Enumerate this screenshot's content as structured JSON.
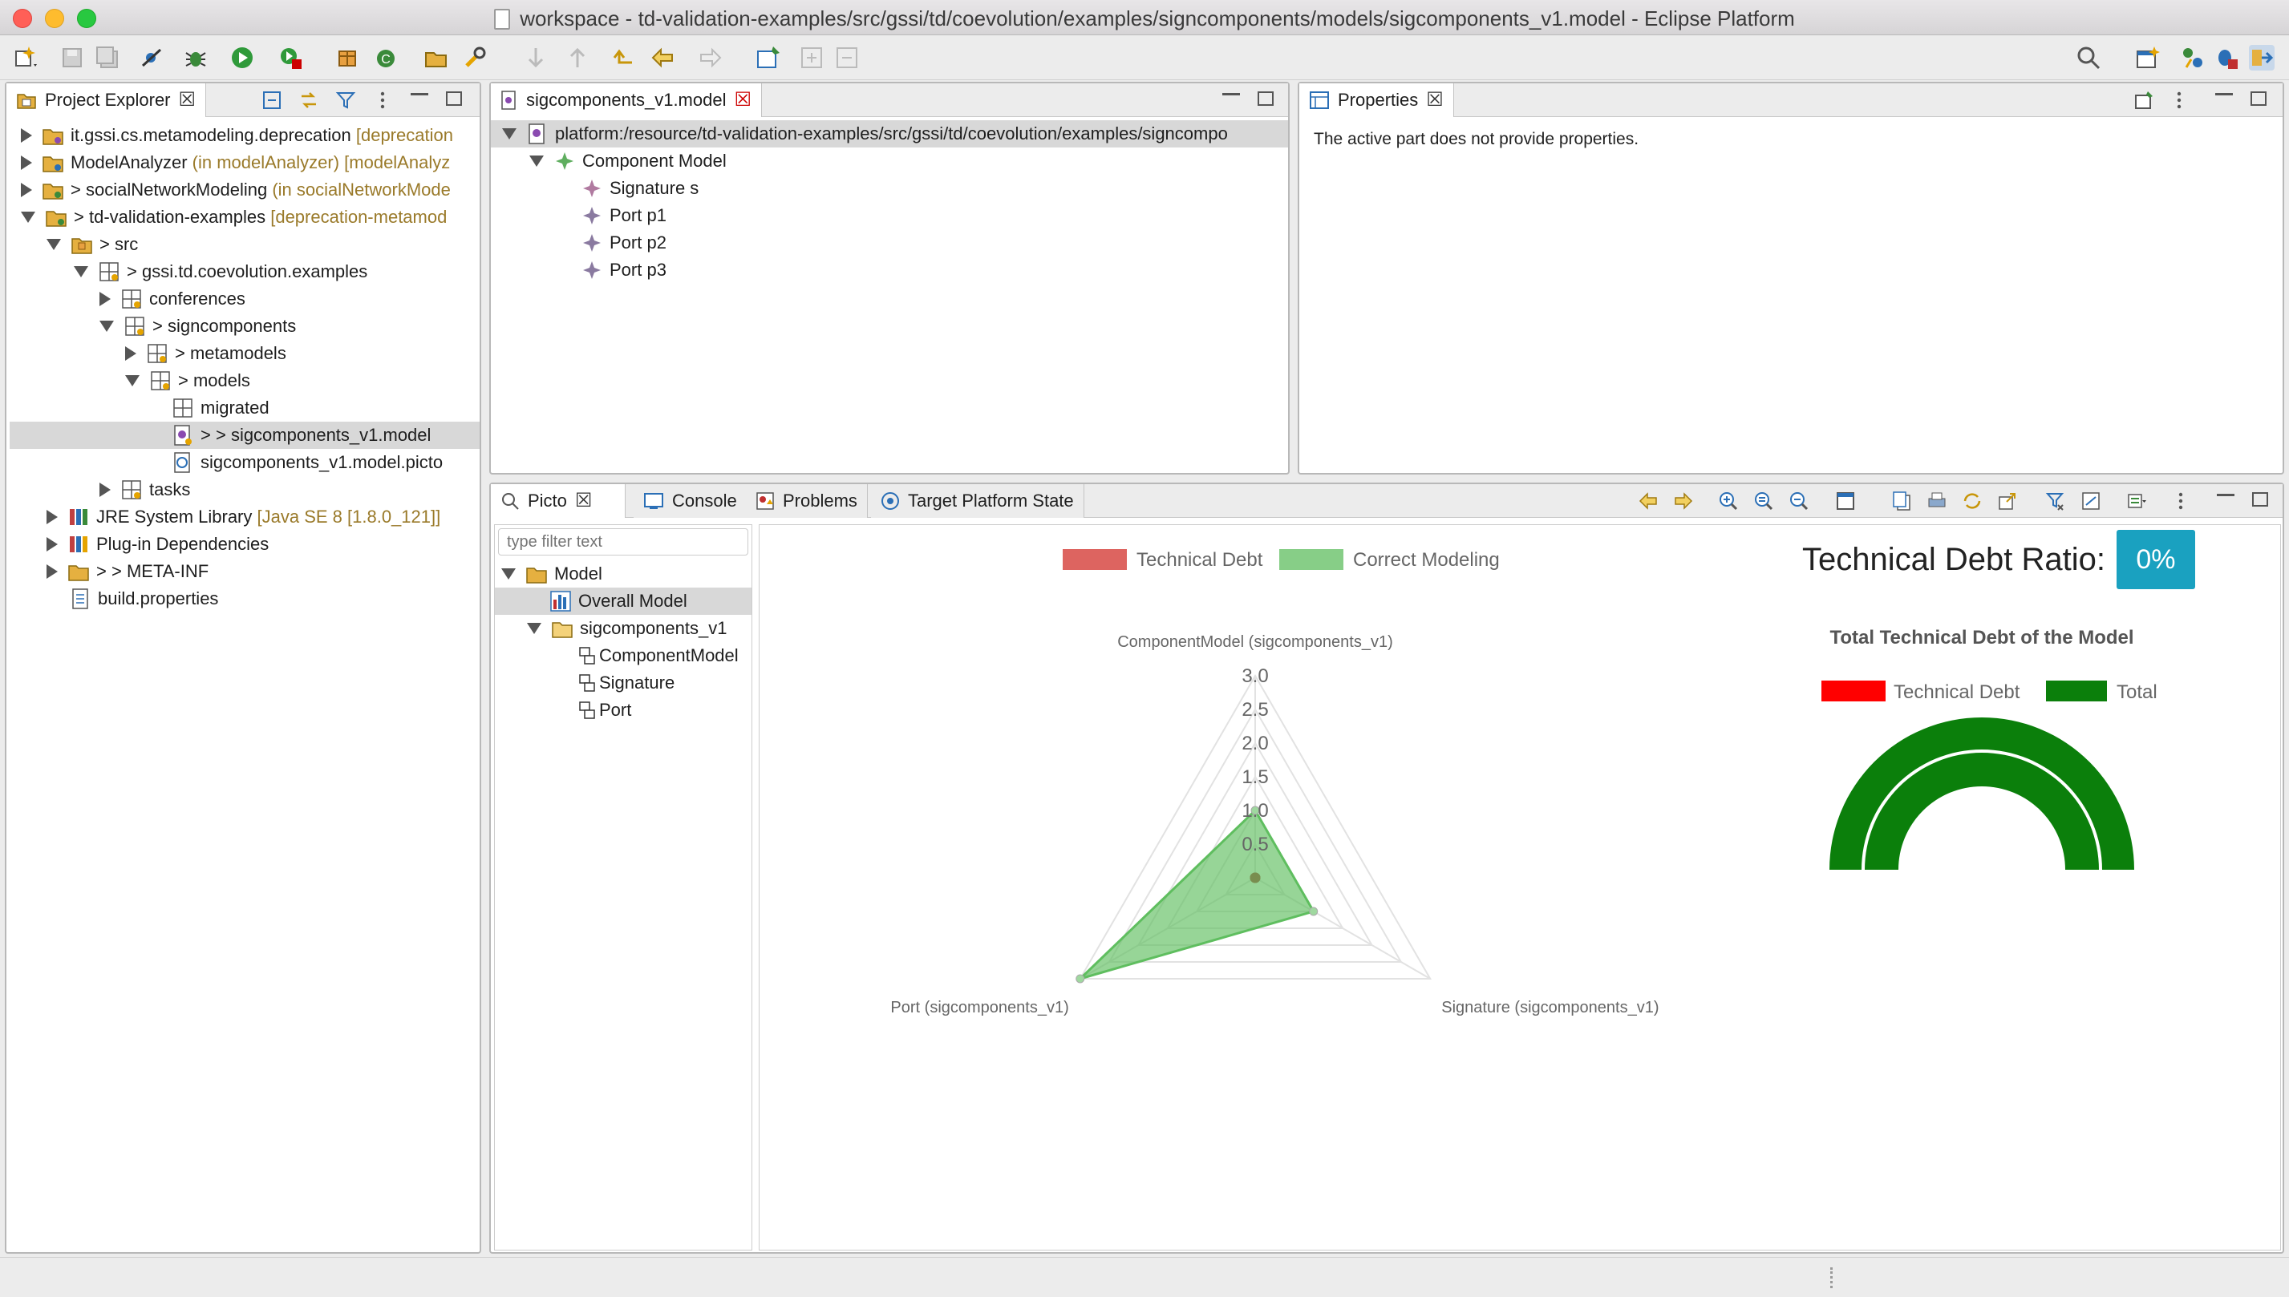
{
  "window": {
    "title": "workspace - td-validation-examples/src/gssi/td/coevolution/examples/signcomponents/models/sigcomponents_v1.model - Eclipse Platform"
  },
  "colors": {
    "accent": "#1aa1c0",
    "green": "#5fbe5f",
    "red": "#d9534f",
    "gauge_green": "#0b7f0b",
    "gauge_red": "#ff0000",
    "project_deco": "#9a7a2a"
  },
  "toolbar": {
    "icons": [
      "new-wizard-icon",
      "save-icon",
      "save-all-icon",
      "skip-breakpoints-icon",
      "debug-icon",
      "run-icon",
      "run-external-icon",
      "new-package-icon",
      "new-class-icon",
      "open-type-icon",
      "search-icon",
      "previous-edit-icon",
      "back-icon",
      "forward-icon",
      "pin-editor-icon",
      "expand-icon",
      "collapse-icon",
      "quick-access-search-icon",
      "perspective-open-icon",
      "perspective-java-icon",
      "perspective-debug-icon",
      "perspective-picto-icon"
    ]
  },
  "project_explorer": {
    "tab_label": "Project Explorer",
    "items": [
      {
        "label": "it.gssi.cs.metamodeling.deprecation",
        "deco": "[deprecation"
      },
      {
        "label": "ModelAnalyzer",
        "deco": "(in modelAnalyzer) [modelAnalyz"
      },
      {
        "prefix": ">",
        "label": "socialNetworkModeling",
        "deco": "(in socialNetworkMode"
      },
      {
        "prefix": ">",
        "label": "td-validation-examples",
        "deco": "[deprecation-metamod"
      },
      {
        "prefix": ">",
        "label": "src"
      },
      {
        "prefix": ">",
        "label": "gssi.td.coevolution.examples"
      },
      {
        "label": "conferences"
      },
      {
        "prefix": ">",
        "label": "signcomponents"
      },
      {
        "prefix": ">",
        "label": "metamodels"
      },
      {
        "prefix": ">",
        "label": "models"
      },
      {
        "label": "migrated"
      },
      {
        "prefix": "> >",
        "label": "sigcomponents_v1.model"
      },
      {
        "label": "sigcomponents_v1.model.picto"
      },
      {
        "label": "tasks"
      },
      {
        "label": "JRE System Library",
        "deco": "[Java SE 8 [1.8.0_121]]"
      },
      {
        "label": "Plug-in Dependencies"
      },
      {
        "prefix": "> >",
        "label": "META-INF"
      },
      {
        "label": "build.properties"
      }
    ]
  },
  "editor": {
    "tab_label": "sigcomponents_v1.model",
    "root": "platform:/resource/td-validation-examples/src/gssi/td/coevolution/examples/signcompo",
    "items": [
      "Component Model",
      "Signature s",
      "Port p1",
      "Port p2",
      "Port p3"
    ]
  },
  "properties": {
    "tab_label": "Properties",
    "message": "The active part does not provide properties."
  },
  "bottom_tabs": {
    "picto": "Picto",
    "console": "Console",
    "problems": "Problems",
    "target": "Target Platform State"
  },
  "picto": {
    "filter_placeholder": "type filter text",
    "tree": [
      "Model",
      "Overall Model",
      "sigcomponents_v1",
      "ComponentModel",
      "Signature",
      "Port"
    ],
    "ratio_label": "Technical Debt Ratio:",
    "ratio_value": "0%",
    "gauge_title": "Total Technical Debt of the Model",
    "gauge_legend": [
      "Technical Debt",
      "Total"
    ]
  },
  "chart_data": {
    "type": "radar",
    "categories": [
      "ComponentModel (sigcomponents_v1)",
      "Signature (sigcomponents_v1)",
      "Port (sigcomponents_v1)"
    ],
    "series": [
      {
        "name": "Technical Debt",
        "values": [
          0,
          0,
          0
        ],
        "color": "#d9534f"
      },
      {
        "name": "Correct Modeling",
        "values": [
          1,
          1,
          3
        ],
        "color": "#5fbe5f"
      }
    ],
    "ticks": [
      "0.5",
      "1.0",
      "1.5",
      "2.0",
      "2.5",
      "3.0"
    ],
    "rmax": 3,
    "grid": true,
    "legend": "top"
  },
  "gauge_data": {
    "type": "doughnut-half",
    "values": {
      "Technical Debt": 0,
      "Total": 1
    }
  }
}
